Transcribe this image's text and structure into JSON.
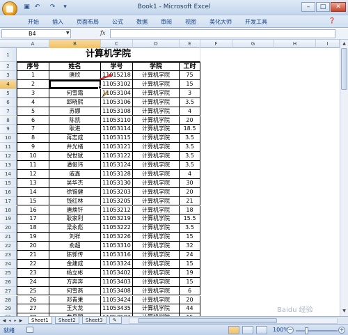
{
  "window": {
    "title": "Book1 - Microsoft Excel"
  },
  "quick_access": {
    "save_icon": "save-icon",
    "undo_icon": "undo-icon",
    "redo_icon": "redo-icon"
  },
  "ribbon": {
    "tabs": [
      "开始",
      "插入",
      "页面布局",
      "公式",
      "数据",
      "审阅",
      "视图",
      "美化大师",
      "开发工具"
    ]
  },
  "formula_bar": {
    "name_box": "B4",
    "fx": "fx",
    "formula": ""
  },
  "columns": [
    "A",
    "B",
    "C",
    "D",
    "E",
    "F",
    "G",
    "H",
    "I"
  ],
  "sheet": {
    "title": "计算机学院",
    "headers": [
      "序号",
      "姓名",
      "学号",
      "学院",
      "工时"
    ],
    "rows": [
      [
        "1",
        "唐欣",
        "11015218",
        "计算机学院",
        "75"
      ],
      [
        "2",
        "",
        "11053102",
        "计算机学院",
        "15"
      ],
      [
        "3",
        "何雪霜",
        "11053104",
        "计算机学院",
        "3"
      ],
      [
        "4",
        "邱晓熙",
        "11053106",
        "计算机学院",
        "3.5"
      ],
      [
        "5",
        "苏娜",
        "11053108",
        "计算机学院",
        "4"
      ],
      [
        "6",
        "陈凯",
        "11053110",
        "计算机学院",
        "20"
      ],
      [
        "7",
        "耿进",
        "11053114",
        "计算机学院",
        "18.5"
      ],
      [
        "8",
        "蒋志成",
        "11053115",
        "计算机学院",
        "3.5"
      ],
      [
        "9",
        "井光绪",
        "11053121",
        "计算机学院",
        "3.5"
      ],
      [
        "10",
        "倪世斌",
        "11053122",
        "计算机学院",
        "3.5"
      ],
      [
        "11",
        "潘俊玮",
        "11053124",
        "计算机学院",
        "3.5"
      ],
      [
        "12",
        "戚鑫",
        "11053128",
        "计算机学院",
        "4"
      ],
      [
        "13",
        "吴华杰",
        "11053130",
        "计算机学院",
        "30"
      ],
      [
        "14",
        "徐锡健",
        "11053203",
        "计算机学院",
        "20"
      ],
      [
        "15",
        "钱红林",
        "11053205",
        "计算机学院",
        "21"
      ],
      [
        "16",
        "唐焕钎",
        "11053212",
        "计算机学院",
        "18"
      ],
      [
        "17",
        "耿家利",
        "11053219",
        "计算机学院",
        "15.5"
      ],
      [
        "18",
        "梁永彪",
        "11053222",
        "计算机学院",
        "3.5"
      ],
      [
        "19",
        "刘祥",
        "11053226",
        "计算机学院",
        "15"
      ],
      [
        "20",
        "俞超",
        "11053310",
        "计算机学院",
        "32"
      ],
      [
        "21",
        "陈郭传",
        "11053316",
        "计算机学院",
        "24"
      ],
      [
        "22",
        "金建成",
        "11053324",
        "计算机学院",
        "15"
      ],
      [
        "23",
        "杨立彬",
        "11053402",
        "计算机学院",
        "19"
      ],
      [
        "24",
        "方奔奔",
        "11053403",
        "计算机学院",
        "15"
      ],
      [
        "25",
        "何雪燕",
        "11053408",
        "计算机学院",
        "6"
      ],
      [
        "26",
        "邓青果",
        "11053424",
        "计算机学院",
        "20"
      ],
      [
        "27",
        "王大龙",
        "11053435",
        "计算机学院",
        "44"
      ],
      [
        "28",
        "曹昌明",
        "11053503",
        "计算机学院",
        "15"
      ]
    ],
    "row_numbers": [
      "1",
      "2",
      "3",
      "4",
      "5",
      "6",
      "7",
      "8",
      "9",
      "10",
      "11",
      "12",
      "13",
      "14",
      "15",
      "16",
      "17",
      "18",
      "19",
      "20",
      "21",
      "22",
      "23",
      "24",
      "25",
      "26",
      "27",
      "28",
      "29",
      "30"
    ]
  },
  "sheet_tabs": [
    "Sheet1",
    "Sheet2",
    "Sheet3"
  ],
  "status": {
    "ready": "就绪",
    "zoom": "100%"
  },
  "colors": {
    "accent": "#15428b",
    "selection": "#f1c15f",
    "annotation": "#e0201a"
  },
  "watermark": "Baidu 经验"
}
